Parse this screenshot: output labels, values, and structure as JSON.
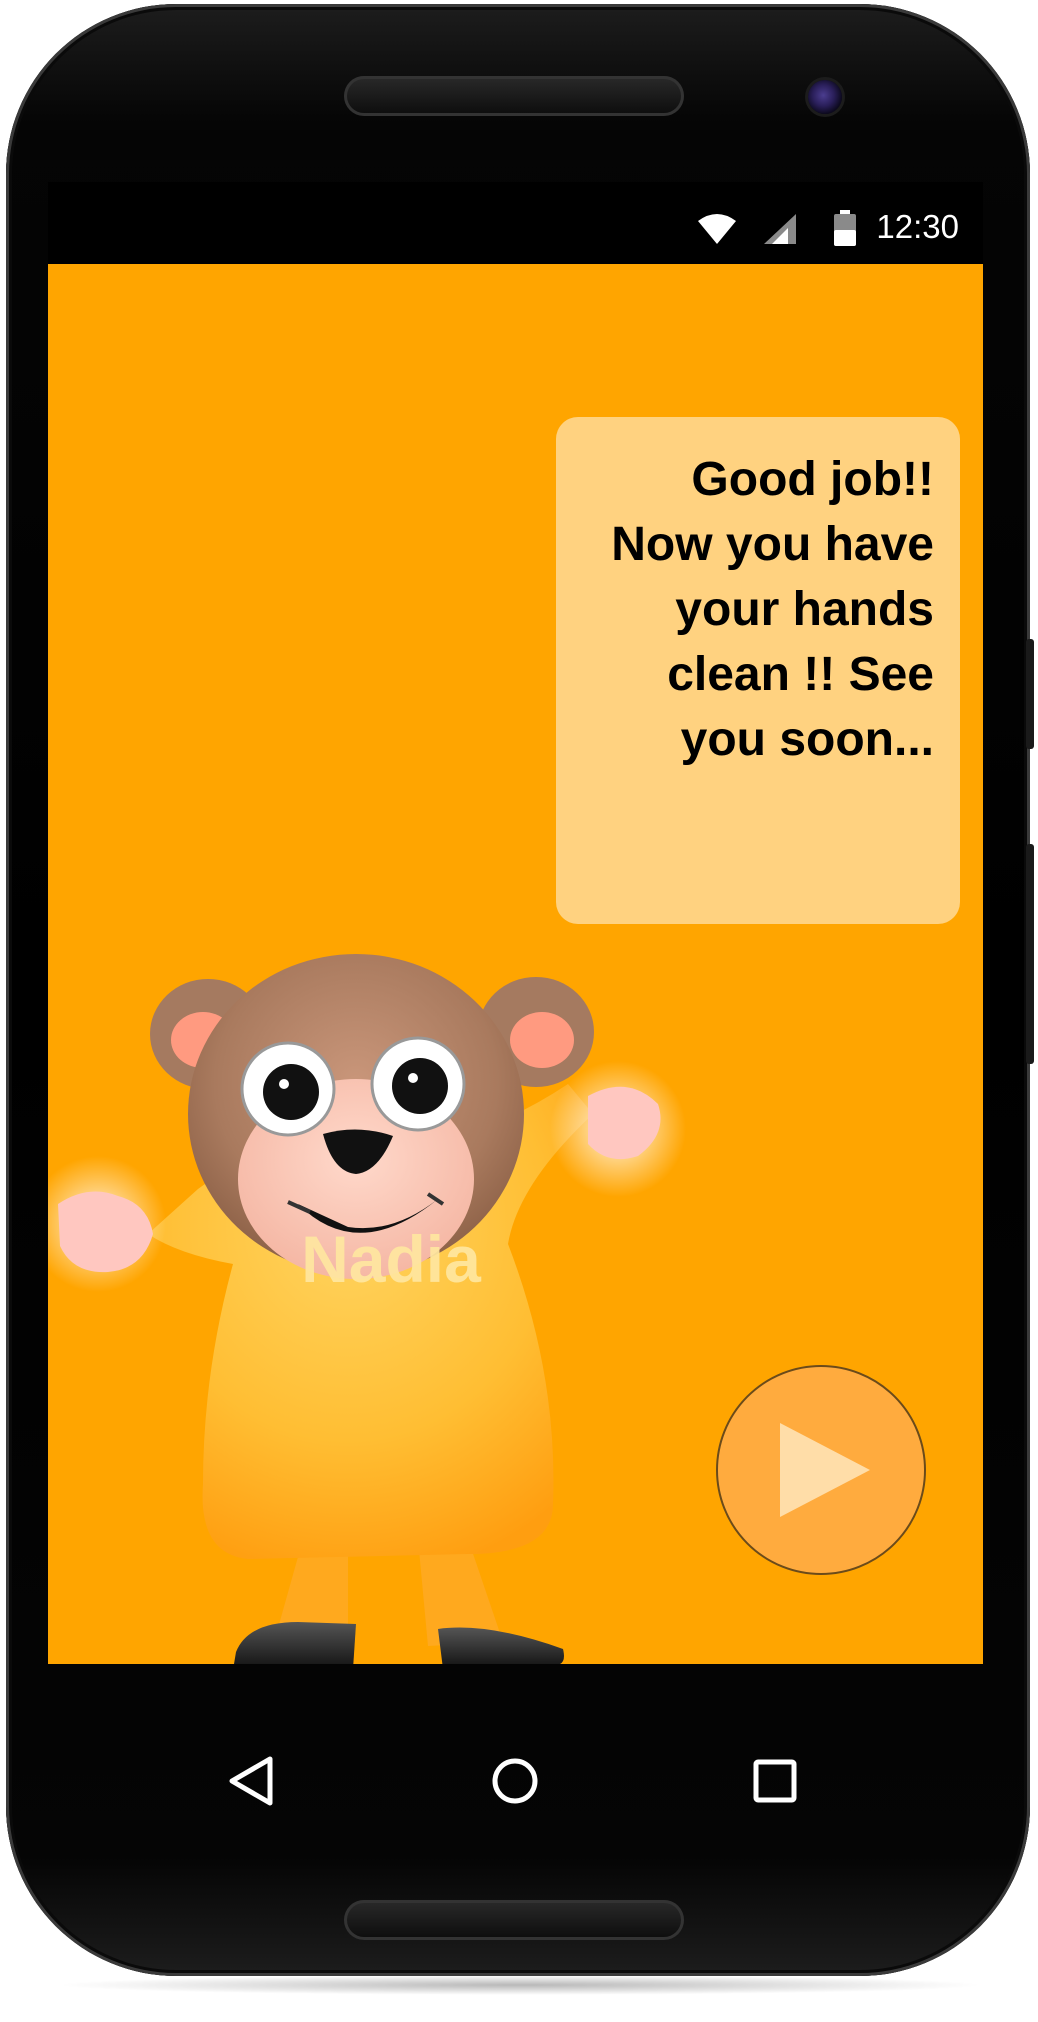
{
  "status_bar": {
    "time": "12:30",
    "icons": [
      "wifi-icon",
      "cellular-signal-icon",
      "battery-icon"
    ]
  },
  "speech_bubble": {
    "lines": [
      "Good job!!",
      "Now you have",
      "your hands",
      "clean !! See",
      "you soon..."
    ]
  },
  "character": {
    "name": "Nadia",
    "description_icon": "bear-mascot"
  },
  "play_button": {
    "icon": "play-icon"
  },
  "nav_bar": {
    "buttons": [
      {
        "icon": "back-triangle-icon"
      },
      {
        "icon": "home-circle-icon"
      },
      {
        "icon": "recents-square-icon"
      }
    ]
  },
  "colors": {
    "screen_background": "#FFA500",
    "bubble_background": "#FFD280",
    "play_button": "#FFAB3E",
    "play_icon": "#FFDDA8",
    "bear_fur": "#B07E5C",
    "bear_shirt": "#FFC23A"
  }
}
